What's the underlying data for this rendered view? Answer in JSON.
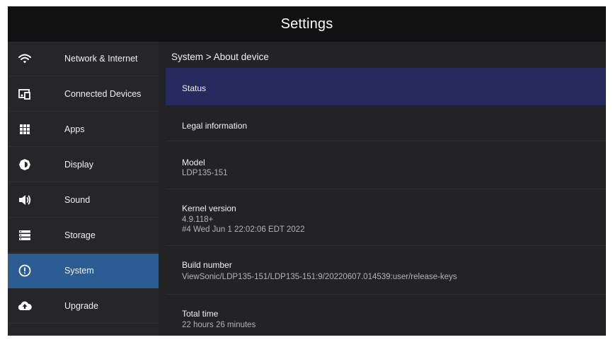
{
  "header": {
    "title": "Settings"
  },
  "sidebar": {
    "items": [
      {
        "label": "Network & Internet",
        "icon": "wifi-icon"
      },
      {
        "label": "Connected Devices",
        "icon": "connected-devices-icon"
      },
      {
        "label": "Apps",
        "icon": "apps-grid-icon"
      },
      {
        "label": "Display",
        "icon": "brightness-icon"
      },
      {
        "label": "Sound",
        "icon": "speaker-icon"
      },
      {
        "label": "Storage",
        "icon": "storage-icon"
      },
      {
        "label": "System",
        "icon": "info-circle-icon",
        "active": true
      },
      {
        "label": "Upgrade",
        "icon": "cloud-upload-icon"
      }
    ]
  },
  "main": {
    "breadcrumb": "System > About device",
    "rows": [
      {
        "title": "Status",
        "selected": true
      },
      {
        "title": "Legal information"
      },
      {
        "title": "Model",
        "value": "LDP135-151"
      },
      {
        "title": "Kernel version",
        "value": "4.9.118+",
        "value2": "#4 Wed Jun 1 22:02:06 EDT 2022"
      },
      {
        "title": "Build number",
        "value": "ViewSonic/LDP135-151/LDP135-151:9/20220607.014539:user/release-keys"
      },
      {
        "title": "Total time",
        "value": "22 hours 26 minutes"
      }
    ]
  },
  "colors": {
    "title_bar": "#111112",
    "background": "#232326",
    "active_sidebar": "#2b5c93",
    "selected_row": "#262a5e"
  }
}
